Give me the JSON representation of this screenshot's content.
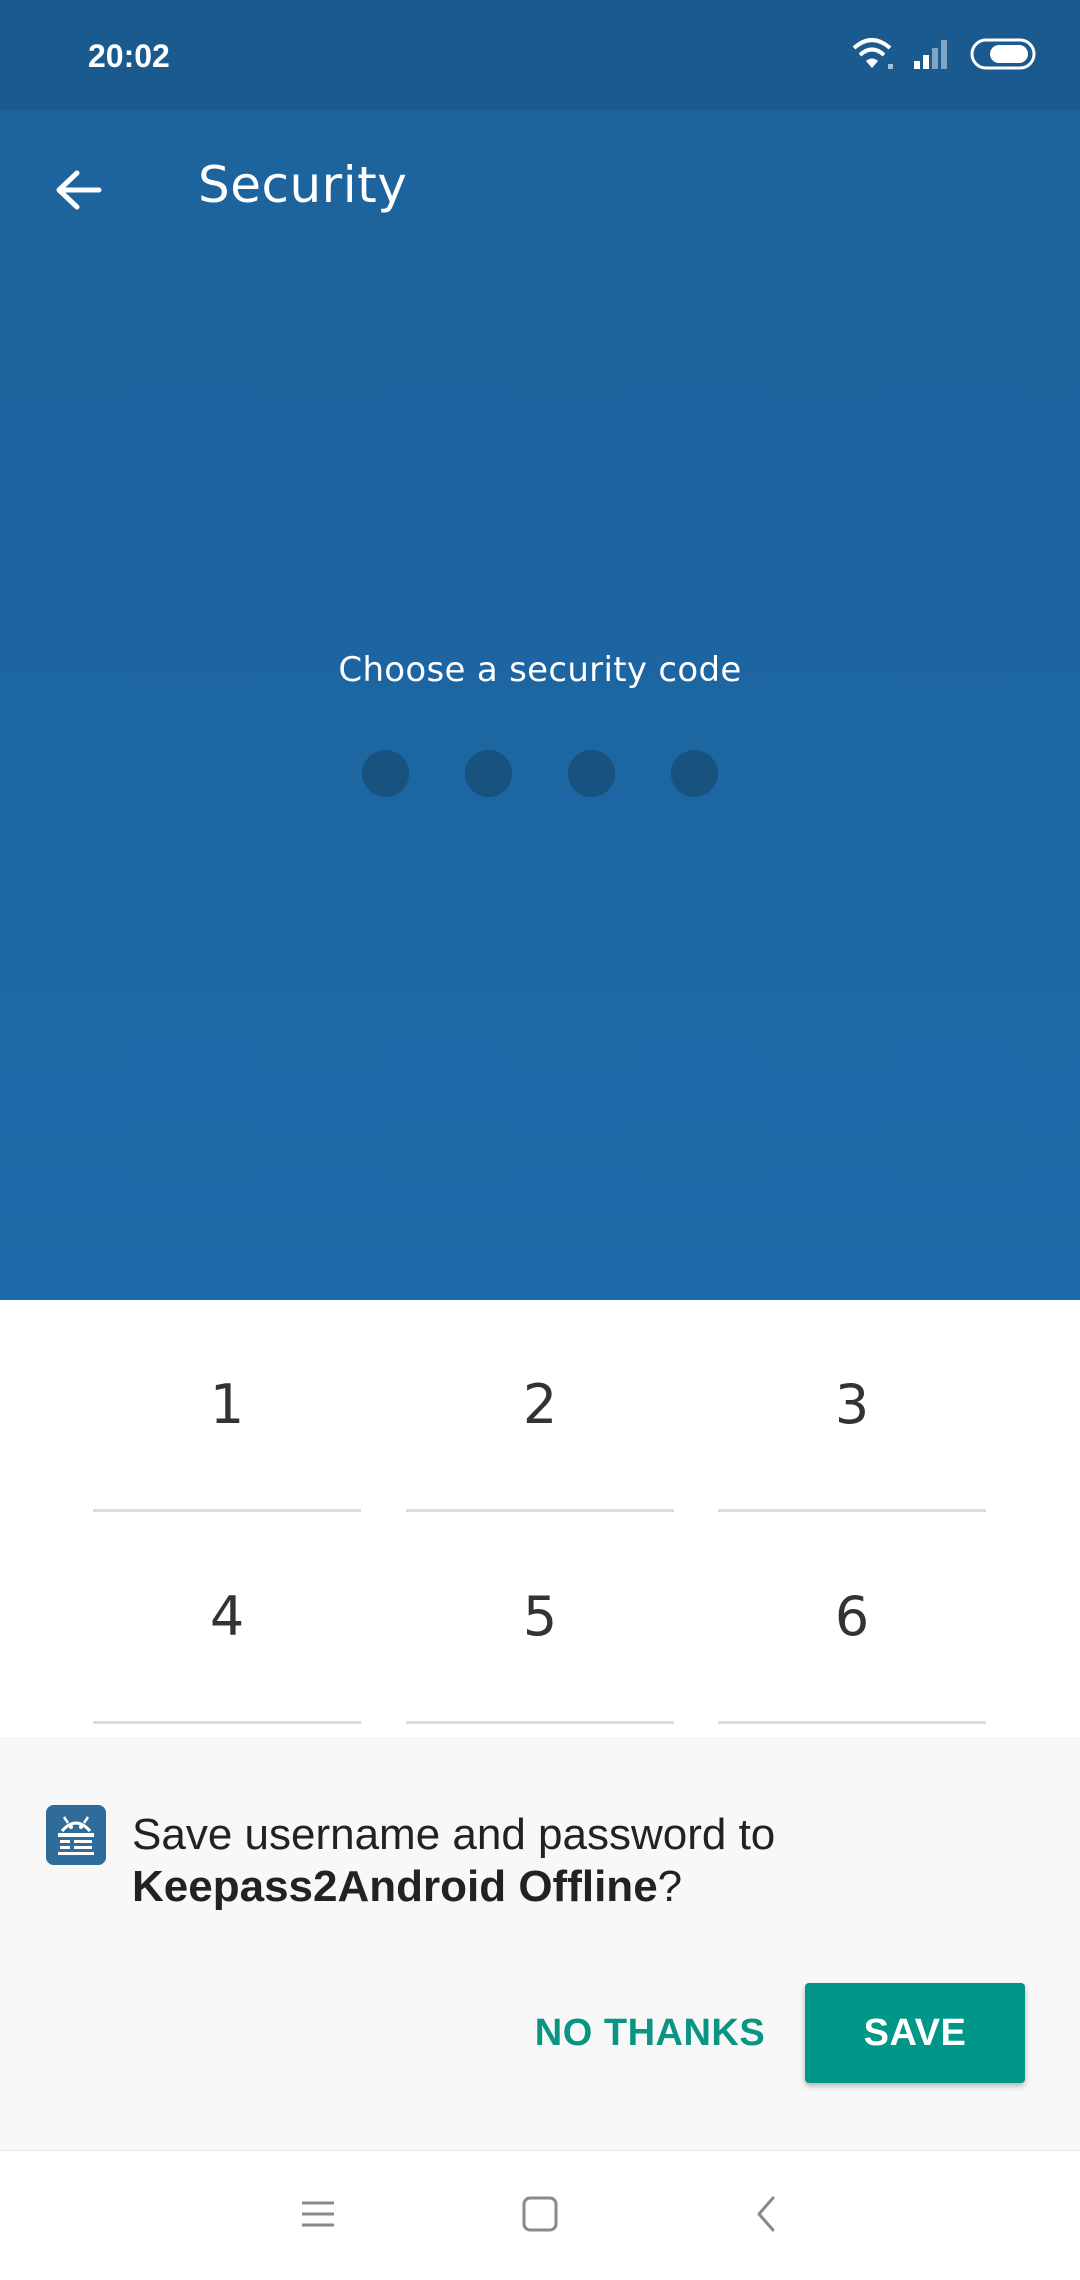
{
  "status_bar": {
    "time": "20:02",
    "icons": [
      "wifi-icon",
      "signal-icon",
      "battery-icon"
    ]
  },
  "toolbar": {
    "title": "Security",
    "back_icon": "arrow-left-icon"
  },
  "pin_entry": {
    "prompt": "Choose a security code",
    "digits_entered": 0,
    "code_length": 4
  },
  "keypad": {
    "keys": [
      "1",
      "2",
      "3",
      "4",
      "5",
      "6"
    ]
  },
  "autofill_prompt": {
    "message_prefix": "Save username and password to",
    "app_name": "Keepass2Android Offline",
    "message_suffix": "?",
    "no_thanks_label": "NO THANKS",
    "save_label": "SAVE",
    "app_icon": "keepass2android-icon"
  },
  "nav_bar": {
    "buttons": [
      "menu-icon",
      "home-icon",
      "back-icon"
    ]
  },
  "colors": {
    "primary": "#1d639c",
    "accent": "#009688",
    "pin_dot": "#18527f"
  }
}
